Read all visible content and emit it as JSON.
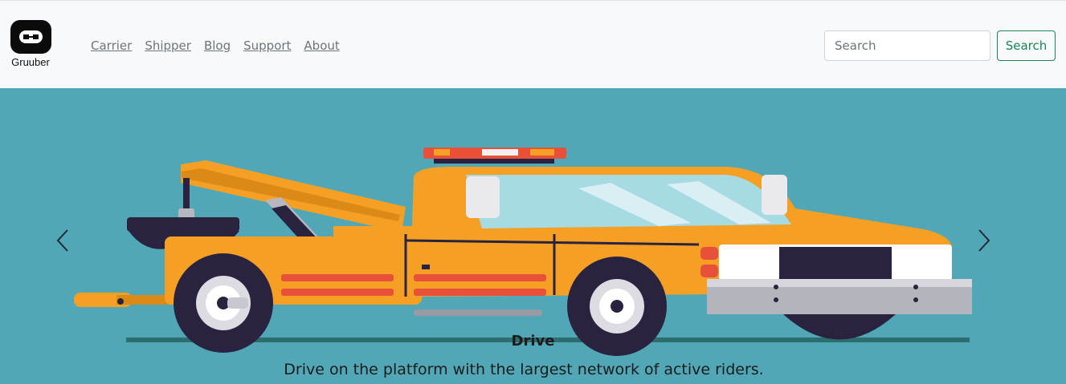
{
  "brand": {
    "name": "Gruuber",
    "logo_icon": "link-icon"
  },
  "nav": {
    "links": [
      {
        "label": "Carrier"
      },
      {
        "label": "Shipper"
      },
      {
        "label": "Blog"
      },
      {
        "label": "Support"
      },
      {
        "label": "About"
      }
    ]
  },
  "search": {
    "placeholder": "Search",
    "value": "",
    "button_label": "Search"
  },
  "carousel": {
    "slide": {
      "caption_title": "Drive",
      "caption_text": "Drive on the platform with the largest network of active riders.",
      "image": "tow-truck-illustration"
    },
    "prev_icon": "chevron-left-icon",
    "next_icon": "chevron-right-icon"
  },
  "colors": {
    "navbar_bg": "#f8f9fa",
    "carousel_bg": "#52a7b7",
    "button_accent": "#198754",
    "truck_orange": "#f5a025",
    "truck_dark": "#2a2340",
    "lightbar_red": "#e8503a"
  }
}
